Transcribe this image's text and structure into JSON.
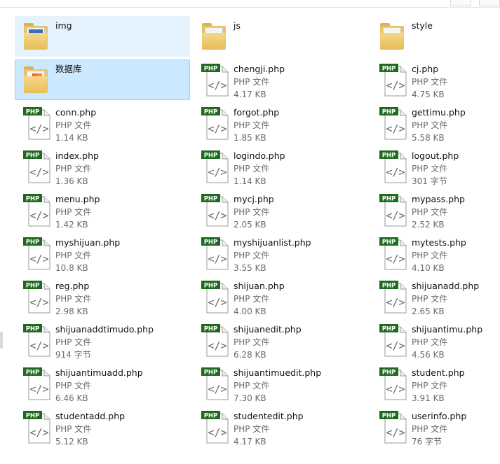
{
  "items": [
    {
      "name": "img",
      "type": "folder",
      "detail": "",
      "size": "",
      "variant": "pic"
    },
    {
      "name": "js",
      "type": "folder",
      "detail": "",
      "size": "",
      "variant": "plain"
    },
    {
      "name": "style",
      "type": "folder",
      "detail": "",
      "size": "",
      "variant": "plain"
    },
    {
      "name": "数据库",
      "type": "folder",
      "detail": "",
      "size": "",
      "variant": "color"
    },
    {
      "name": "chengji.php",
      "type": "php",
      "detail": "PHP 文件",
      "size": "4.17 KB"
    },
    {
      "name": "cj.php",
      "type": "php",
      "detail": "PHP 文件",
      "size": "4.75 KB"
    },
    {
      "name": "conn.php",
      "type": "php",
      "detail": "PHP 文件",
      "size": "1.14 KB"
    },
    {
      "name": "forgot.php",
      "type": "php",
      "detail": "PHP 文件",
      "size": "1.85 KB"
    },
    {
      "name": "gettimu.php",
      "type": "php",
      "detail": "PHP 文件",
      "size": "5.58 KB"
    },
    {
      "name": "index.php",
      "type": "php",
      "detail": "PHP 文件",
      "size": "1.36 KB"
    },
    {
      "name": "logindo.php",
      "type": "php",
      "detail": "PHP 文件",
      "size": "1.14 KB"
    },
    {
      "name": "logout.php",
      "type": "php",
      "detail": "PHP 文件",
      "size": "301 字节"
    },
    {
      "name": "menu.php",
      "type": "php",
      "detail": "PHP 文件",
      "size": "1.42 KB"
    },
    {
      "name": "mycj.php",
      "type": "php",
      "detail": "PHP 文件",
      "size": "2.05 KB"
    },
    {
      "name": "mypass.php",
      "type": "php",
      "detail": "PHP 文件",
      "size": "2.52 KB"
    },
    {
      "name": "myshijuan.php",
      "type": "php",
      "detail": "PHP 文件",
      "size": "10.8 KB"
    },
    {
      "name": "myshijuanlist.php",
      "type": "php",
      "detail": "PHP 文件",
      "size": "3.55 KB"
    },
    {
      "name": "mytests.php",
      "type": "php",
      "detail": "PHP 文件",
      "size": "4.10 KB"
    },
    {
      "name": "reg.php",
      "type": "php",
      "detail": "PHP 文件",
      "size": "2.98 KB"
    },
    {
      "name": "shijuan.php",
      "type": "php",
      "detail": "PHP 文件",
      "size": "4.00 KB"
    },
    {
      "name": "shijuanadd.php",
      "type": "php",
      "detail": "PHP 文件",
      "size": "2.65 KB"
    },
    {
      "name": "shijuanaddtimudo.php",
      "type": "php",
      "detail": "PHP 文件",
      "size": "914 字节"
    },
    {
      "name": "shijuanedit.php",
      "type": "php",
      "detail": "PHP 文件",
      "size": "6.28 KB"
    },
    {
      "name": "shijuantimu.php",
      "type": "php",
      "detail": "PHP 文件",
      "size": "4.56 KB"
    },
    {
      "name": "shijuantimuadd.php",
      "type": "php",
      "detail": "PHP 文件",
      "size": "6.46 KB"
    },
    {
      "name": "shijuantimuedit.php",
      "type": "php",
      "detail": "PHP 文件",
      "size": "7.30 KB"
    },
    {
      "name": "student.php",
      "type": "php",
      "detail": "PHP 文件",
      "size": "3.91 KB"
    },
    {
      "name": "studentadd.php",
      "type": "php",
      "detail": "PHP 文件",
      "size": "5.12 KB"
    },
    {
      "name": "studentedit.php",
      "type": "php",
      "detail": "PHP 文件",
      "size": "4.17 KB"
    },
    {
      "name": "userinfo.php",
      "type": "php",
      "detail": "PHP 文件",
      "size": "76 字节"
    }
  ],
  "icon_label": "PHP",
  "colors": {
    "php_badge": "#1f6a1f",
    "php_badge_text": "#ffffff",
    "selection_light": "#e5f3ff",
    "selection": "#cce8ff",
    "selection_border": "#99d1ff",
    "meta_text": "#6b6b6b"
  }
}
